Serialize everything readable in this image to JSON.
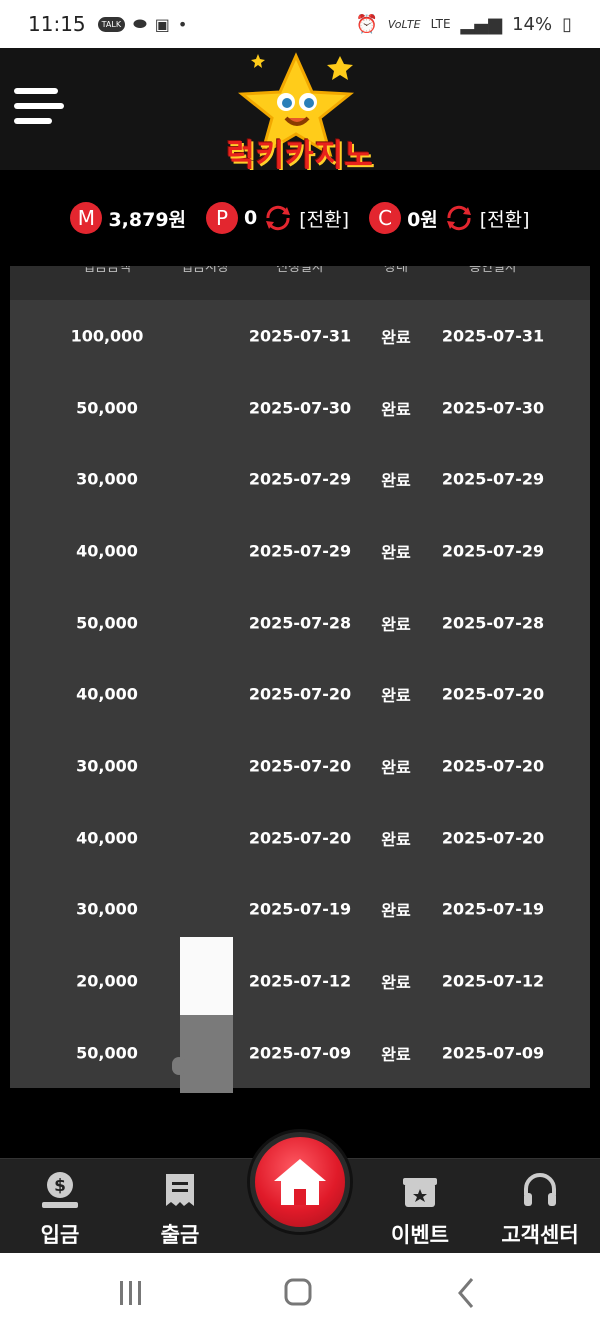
{
  "status_bar": {
    "time": "11:15",
    "talk_badge": "TALK",
    "network": "LTE",
    "volte": "VoLTE",
    "battery": "14%"
  },
  "header": {
    "logo_text": "럭키카지노",
    "menu_icon": "hamburger-icon"
  },
  "points": {
    "money_badge": "M",
    "money_value": "3,879원",
    "point_badge": "P",
    "point_value": "0",
    "convert_label_1": "[전환]",
    "casino_badge": "C",
    "casino_value": "0원",
    "convert_label_2": "[전환]"
  },
  "table": {
    "headers": [
      "입금금액",
      "입금시장",
      "신청일자",
      "상태",
      "승인일자"
    ],
    "rows": [
      {
        "amount": "100,000",
        "requested": "2025-07-31",
        "status": "완료",
        "approved": "2025-07-31"
      },
      {
        "amount": "50,000",
        "requested": "2025-07-30",
        "status": "완료",
        "approved": "2025-07-30"
      },
      {
        "amount": "30,000",
        "requested": "2025-07-29",
        "status": "완료",
        "approved": "2025-07-29"
      },
      {
        "amount": "40,000",
        "requested": "2025-07-29",
        "status": "완료",
        "approved": "2025-07-29"
      },
      {
        "amount": "50,000",
        "requested": "2025-07-28",
        "status": "완료",
        "approved": "2025-07-28"
      },
      {
        "amount": "40,000",
        "requested": "2025-07-20",
        "status": "완료",
        "approved": "2025-07-20"
      },
      {
        "amount": "30,000",
        "requested": "2025-07-20",
        "status": "완료",
        "approved": "2025-07-20"
      },
      {
        "amount": "40,000",
        "requested": "2025-07-20",
        "status": "완료",
        "approved": "2025-07-20"
      },
      {
        "amount": "30,000",
        "requested": "2025-07-19",
        "status": "완료",
        "approved": "2025-07-19"
      },
      {
        "amount": "20,000",
        "requested": "2025-07-12",
        "status": "완료",
        "approved": "2025-07-12"
      },
      {
        "amount": "50,000",
        "requested": "2025-07-09",
        "status": "완료",
        "approved": "2025-07-09"
      }
    ]
  },
  "bottom_nav": {
    "deposit": "입금",
    "withdraw": "출금",
    "event": "이벤트",
    "support": "고객센터"
  },
  "colors": {
    "accent_red": "#e3262f",
    "background": "#000000",
    "table_bg": "#3a3a3a"
  }
}
